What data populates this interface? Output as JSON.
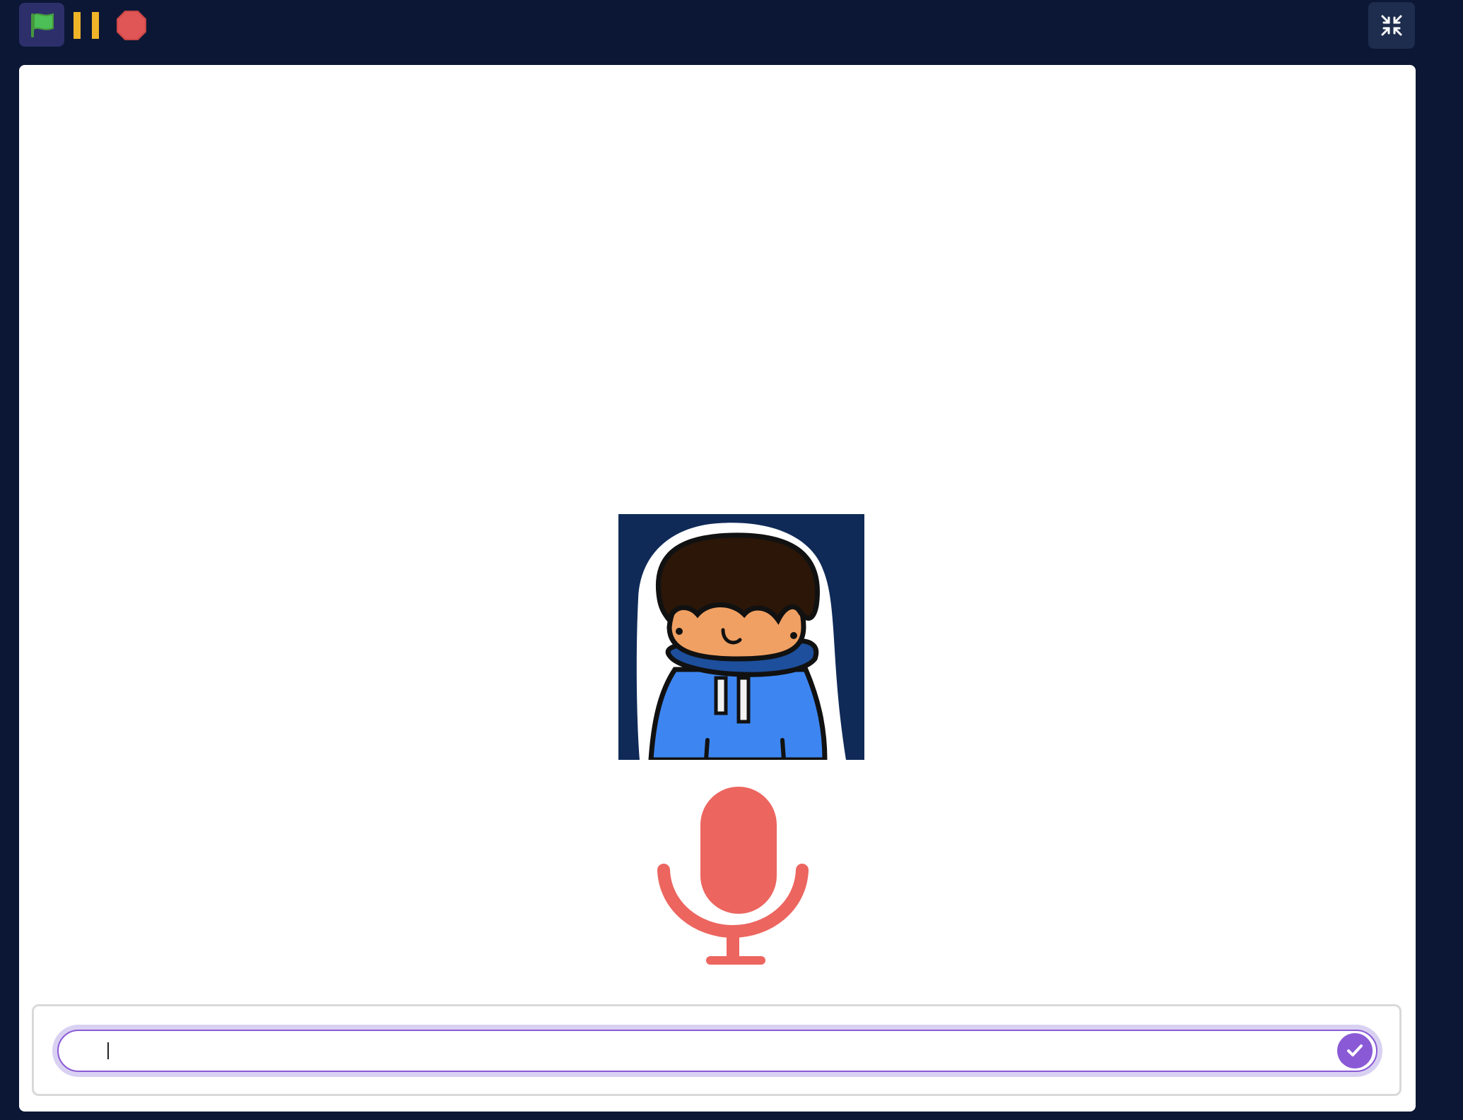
{
  "toolbar": {
    "green_flag_icon": "green-flag-icon",
    "pause_icon": "pause-icon",
    "stop_icon": "stop-icon",
    "unfullscreen_icon": "unfullscreen-icon"
  },
  "stage": {
    "sprite_icon": "hoodie-character",
    "microphone_icon": "microphone-icon"
  },
  "ask_prompt": {
    "input_value": "",
    "submit_icon": "checkmark-icon"
  },
  "colors": {
    "background": "#0b1735",
    "stage": "#ffffff",
    "flag_green": "#4cbf56",
    "pause_yellow": "#f0b429",
    "stop_red": "#e05555",
    "mic_red": "#ec655f",
    "accent_purple": "#8a5ad6"
  }
}
